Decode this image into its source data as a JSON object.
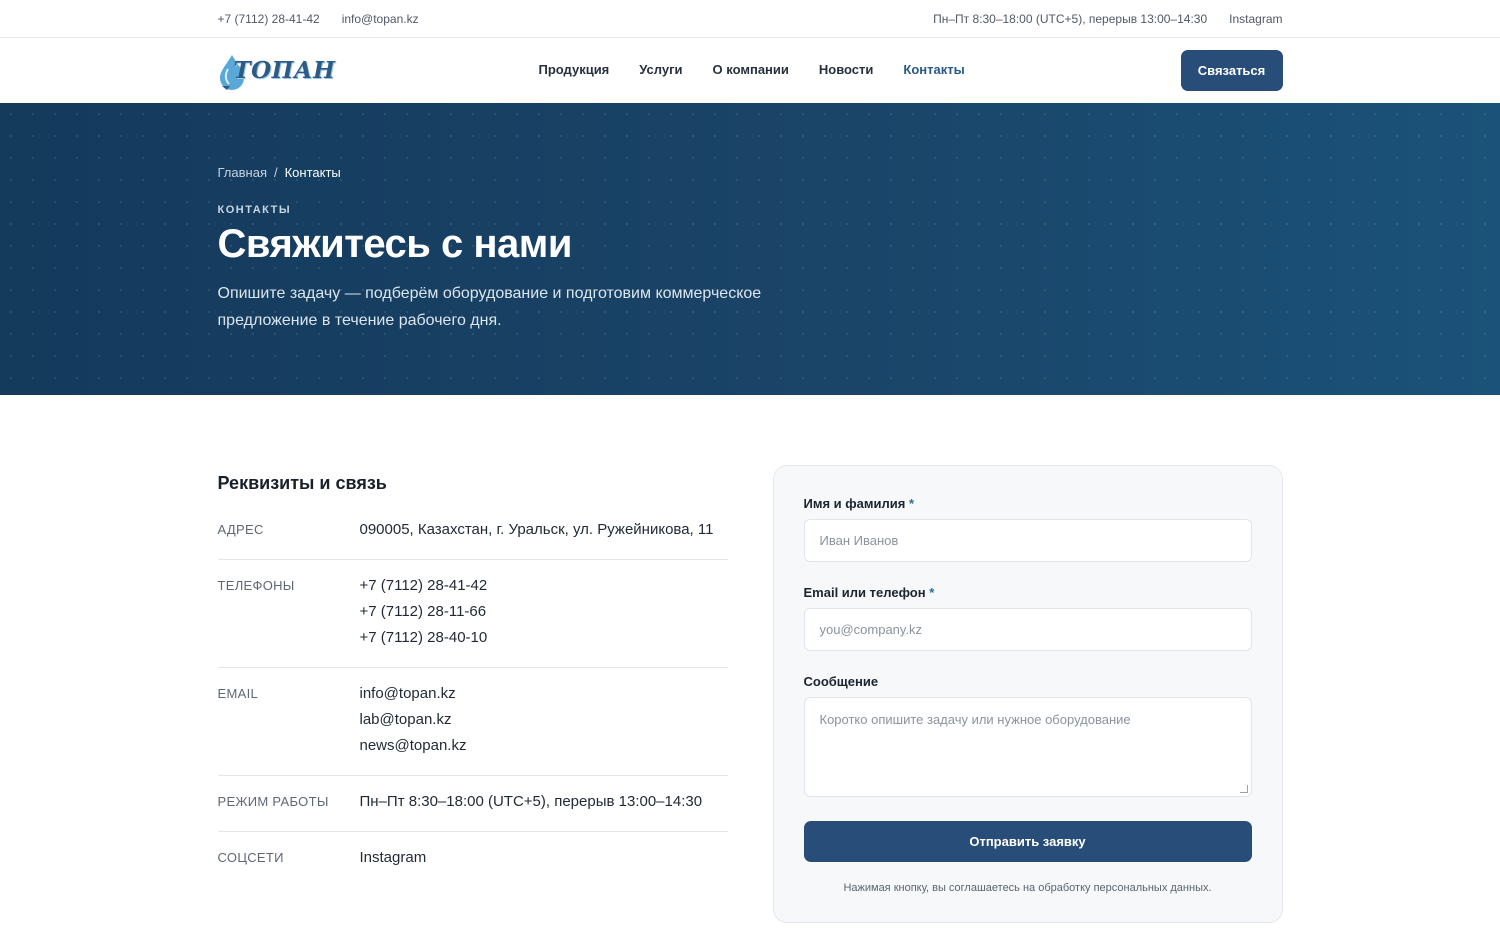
{
  "topbar": {
    "phone": "+7 (7112) 28-41-42",
    "email": "info@topan.kz",
    "hours": "Пн–Пт 8:30–18:00 (UTC+5), перерыв 13:00–14:30",
    "social": "Instagram"
  },
  "header": {
    "logo_text": "ТОПАН",
    "nav": [
      {
        "label": "Продукция"
      },
      {
        "label": "Услуги"
      },
      {
        "label": "О компании"
      },
      {
        "label": "Новости"
      },
      {
        "label": "Контакты"
      }
    ],
    "active_nav": "Контакты",
    "cta_label": "Связаться"
  },
  "hero": {
    "breadcrumb_home": "Главная",
    "breadcrumb_sep": "/",
    "breadcrumb_current": "Контакты",
    "eyebrow": "КОНТАКТЫ",
    "title": "Свяжитесь с нами",
    "subtitle": "Опишите задачу — подберём оборудование и подготовим коммерческое предложение в течение рабочего дня."
  },
  "requisites": {
    "title": "Реквизиты и связь",
    "address_label": "Адрес",
    "address": "090005, Казахстан, г. Уральск, ул. Ружейникова, 11",
    "phones_label": "Телефоны",
    "phones": [
      "+7 (7112) 28-41-42",
      "+7 (7112) 28-11-66",
      "+7 (7112) 28-40-10"
    ],
    "email_label": "Email",
    "emails": [
      "info@topan.kz",
      "lab@topan.kz",
      "news@topan.kz"
    ],
    "hours_label": "Режим работы",
    "hours": "Пн–Пт 8:30–18:00 (UTC+5), перерыв 13:00–14:30",
    "social_label": "Соцсети",
    "social": "Instagram"
  },
  "form": {
    "name_label": "Имя и фамилия",
    "name_placeholder": "Иван Иванов",
    "contact_label": "Email или телефон",
    "contact_placeholder": "you@company.kz",
    "message_label": "Сообщение",
    "message_placeholder": "Коротко опишите задачу или нужное оборудование",
    "required_mark": "*",
    "submit_label": "Отправить заявку",
    "consent": "Нажимая кнопку, вы соглашаетесь на обработку персональных данных."
  },
  "colors": {
    "brand": "#284d78",
    "hero_dark": "#143a5c",
    "accent_link": "#275a86"
  }
}
